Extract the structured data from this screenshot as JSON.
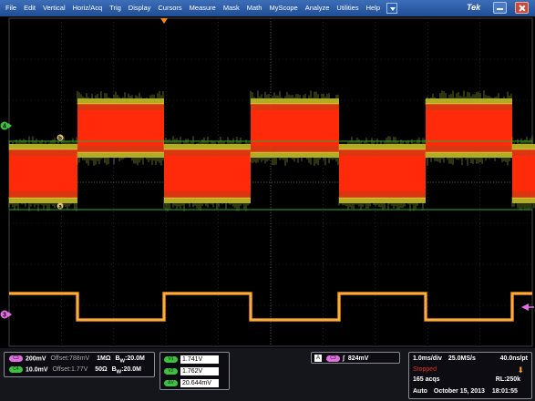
{
  "menu": {
    "items": [
      "File",
      "Edit",
      "Vertical",
      "Horiz/Acq",
      "Trig",
      "Display",
      "Cursors",
      "Measure",
      "Mask",
      "Math",
      "MyScope",
      "Analyze",
      "Utilities",
      "Help"
    ],
    "logo": "Tek"
  },
  "colors": {
    "ch1": "#e8d02a",
    "ch3": "#e070e0",
    "ch4": "#3ec040",
    "trace_red": "#f23c14",
    "trace_orange": "#f08a14",
    "cursor_line": "#2ea82e"
  },
  "markers": {
    "ch4": "4",
    "ch3": "3",
    "cursor_a": "a",
    "cursor_b": "b"
  },
  "channels": [
    {
      "id": "ch3",
      "chip": "C3",
      "scale": "200mV",
      "offset": "Offset:788mV",
      "impedance": "1MΩ",
      "bw_prefix": "B",
      "bw_sub": "W",
      "bw_val": ":20.0M"
    },
    {
      "id": "ch4",
      "chip": "C4",
      "scale": "10.0mV",
      "offset": "Offset:1.77V",
      "impedance": "50Ω",
      "bw_prefix": "B",
      "bw_sub": "W",
      "bw_val": ":20.0M"
    }
  ],
  "cursors": [
    {
      "chip": "V1",
      "value": "1.741V"
    },
    {
      "chip": "V2",
      "value": "1.762V"
    },
    {
      "chip": "ΔV",
      "value": "20.644mV"
    }
  ],
  "trigger": {
    "label": "A",
    "chip": "C3",
    "level": "824mV"
  },
  "horizontal": {
    "time_div": "1.0ms/div",
    "sample_rate": "25.0MS/s",
    "resolution": "40.0ns/pt",
    "state": "Stopped",
    "acqs": "165 acqs",
    "record_length": "RL:250k",
    "mode": "Auto",
    "date": "October 15, 2013",
    "time": "18:01:55"
  }
}
